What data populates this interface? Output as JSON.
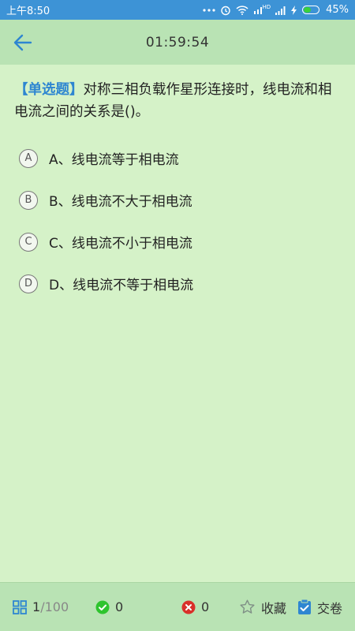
{
  "status_bar": {
    "time": "上午8:50",
    "battery_level": "45%",
    "network_label": "HD",
    "colors": {
      "bar": "#3d93d6",
      "battery_fill": "#3ad13a"
    }
  },
  "header": {
    "timer": "01:59:54"
  },
  "question": {
    "type_label": "【单选题】",
    "text": "对称三相负载作星形连接时，线电流和相电流之间的关系是()。"
  },
  "options": [
    {
      "letter": "A",
      "text": "A、线电流等于相电流"
    },
    {
      "letter": "B",
      "text": "B、线电流不大于相电流"
    },
    {
      "letter": "C",
      "text": "C、线电流不小于相电流"
    },
    {
      "letter": "D",
      "text": "D、线电流不等于相电流"
    }
  ],
  "bottom_bar": {
    "progress_current": "1",
    "progress_total": "/100",
    "correct_count": "0",
    "wrong_count": "0",
    "favorite_label": "收藏",
    "submit_label": "交卷",
    "icons": [
      "grid-icon",
      "check-circle-icon",
      "x-circle-icon",
      "star-icon",
      "clipboard-icon"
    ]
  },
  "theme": {
    "background": "#d5f2c8",
    "bar": "#b9e3b4",
    "accent": "#2e86d1",
    "correct": "#2ec42e",
    "wrong": "#d9302a"
  }
}
